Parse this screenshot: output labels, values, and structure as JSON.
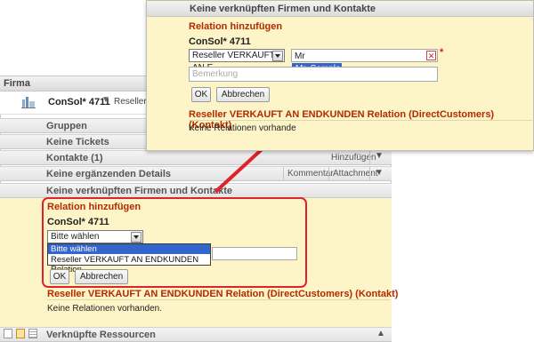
{
  "company_panel": {
    "header": "Firma",
    "company_name": "ConSol* 4711",
    "company_type": "Reseller",
    "sections": {
      "groups": "Gruppen",
      "tickets": "Keine Tickets",
      "contacts": "Kontakte (1)",
      "contacts_add": "Hinzufügen",
      "details": "Keine ergänzenden Details",
      "details_comment": "Kommentar",
      "details_attachment": "Attachment",
      "linked": "Keine verknüpften Firmen und Kontakte",
      "resources": "Verknüpfte Ressourcen"
    },
    "relation_form": {
      "title": "Relation hinzufügen",
      "company": "ConSol* 4711",
      "select_value": "Bitte wählen",
      "options": [
        "Bitte wählen",
        "Reseller VERKAUFT AN ENDKUNDEN Relation"
      ],
      "ok_label": "OK",
      "cancel_label": "Abbrechen",
      "relation_heading": "Reseller VERKAUFT AN ENDKUNDEN Relation (DirectCustomers) (Kontakt)",
      "no_relations": "Keine Relationen vorhanden."
    }
  },
  "zoom_panel": {
    "header": "Keine verknüpften Firmen und Kontakte",
    "title": "Relation hinzufügen",
    "company": "ConSol* 4711",
    "select_value": "Reseller VERKAUFT AN E",
    "search_value": "Mr",
    "required_mark": "*",
    "suggestion": "Mr. Sample",
    "remark_placeholder": "Bemerkung",
    "ok_label": "OK",
    "cancel_label": "Abbrechen",
    "relation_heading": "Reseller VERKAUFT AN ENDKUNDEN Relation (DirectCustomers) (Kontakt)",
    "no_relations": "Keine Relationen vorhande"
  },
  "colors": {
    "accent_red": "#b22a00",
    "highlight_border": "#e0232a",
    "form_bg": "#fdf4c8",
    "selection_blue": "#3366cc"
  }
}
